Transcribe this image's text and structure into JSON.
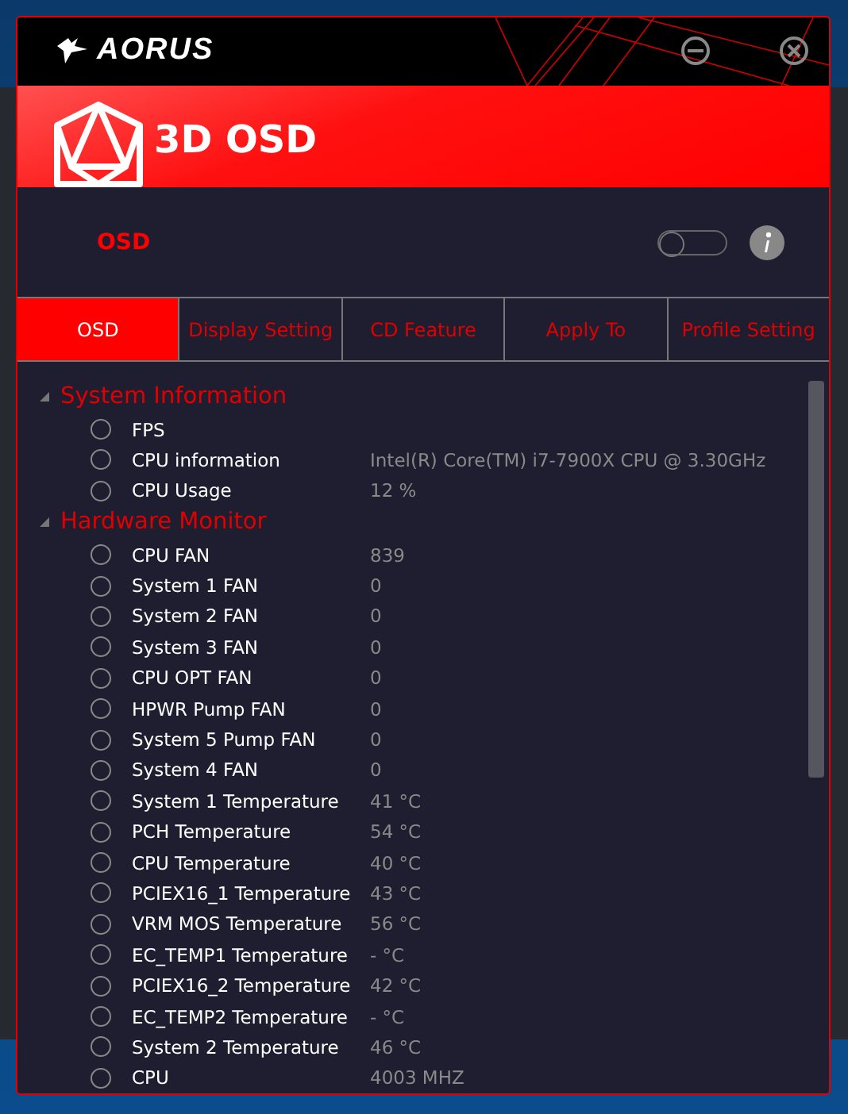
{
  "window": {
    "logo": "AORUS",
    "title": "3D OSD"
  },
  "osd": {
    "label": "OSD",
    "on": false
  },
  "tabs": [
    {
      "label": "OSD",
      "selected": true
    },
    {
      "label": "Display Setting",
      "selected": false
    },
    {
      "label": "CD Feature",
      "selected": false
    },
    {
      "label": "Apply To",
      "selected": false
    },
    {
      "label": "Profile Setting",
      "selected": false
    }
  ],
  "groups": [
    {
      "title": "System Information",
      "expanded": true,
      "children": [
        {
          "label": "FPS",
          "checked": false
        },
        {
          "label": "CPU information",
          "value": "Intel(R) Core(TM) i7-7900X CPU @ 3.30GHz",
          "checked": false
        },
        {
          "label": "CPU Usage",
          "value": "12 %",
          "checked": false
        }
      ]
    },
    {
      "title": "Hardware Monitor",
      "expanded": true,
      "children": [
        {
          "label": "CPU FAN",
          "value": "839",
          "checked": false
        },
        {
          "label": "System 1 FAN",
          "value": "0",
          "checked": false
        },
        {
          "label": "System 2 FAN",
          "value": "0",
          "checked": false
        },
        {
          "label": "System 3 FAN",
          "value": "0",
          "checked": false
        },
        {
          "label": "CPU OPT FAN",
          "value": "0",
          "checked": false
        },
        {
          "label": "HPWR Pump FAN",
          "value": "0",
          "checked": false
        },
        {
          "label": "System 5 Pump FAN",
          "value": "0",
          "checked": false
        },
        {
          "label": "System 4 FAN",
          "value": "0",
          "checked": false
        },
        {
          "label": "System 1 Temperature",
          "value": "41 °C",
          "checked": false
        },
        {
          "label": "PCH Temperature",
          "value": "54 °C",
          "checked": false
        },
        {
          "label": "CPU Temperature",
          "value": "40 °C",
          "checked": false
        },
        {
          "label": "PCIEX16_1 Temperature",
          "value": "43 °C",
          "checked": false
        },
        {
          "label": "VRM MOS Temperature",
          "value": "56 °C",
          "checked": false
        },
        {
          "label": "EC_TEMP1 Temperature",
          "value": "- °C",
          "checked": false
        },
        {
          "label": "PCIEX16_2 Temperature",
          "value": "42 °C",
          "checked": false
        },
        {
          "label": "EC_TEMP2 Temperature",
          "value": "- °C",
          "checked": false
        },
        {
          "label": "System 2 Temperature",
          "value": "46 °C",
          "checked": false
        },
        {
          "label": "CPU",
          "value": "4003 MHZ",
          "checked": false
        }
      ]
    }
  ]
}
